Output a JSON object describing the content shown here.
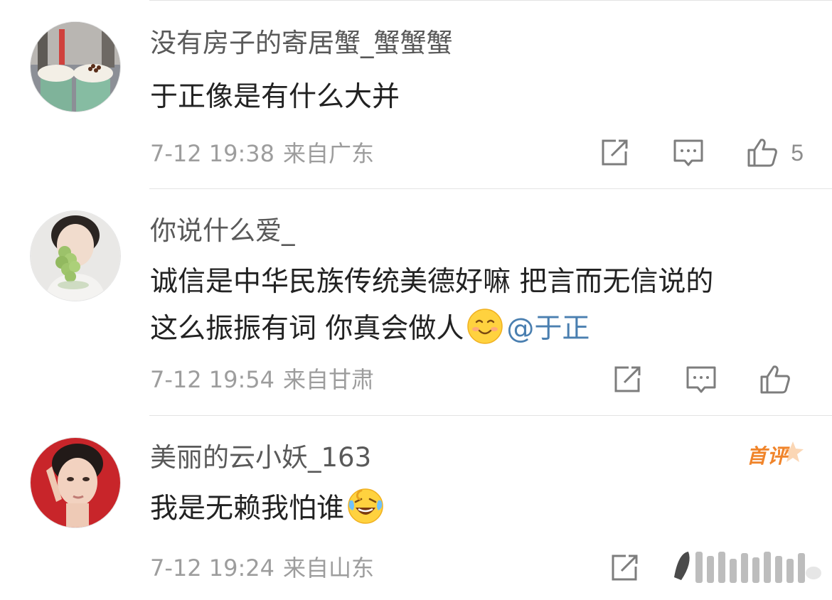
{
  "comments": [
    {
      "username": "没有房子的寄居蟹_蟹蟹蟹",
      "text": "于正像是有什么大并",
      "time": "7-12 19:38",
      "location": "来自广东",
      "likes": "5"
    },
    {
      "username": "你说什么爱_",
      "text_line1": "诚信是中华民族传统美德好嘛 把言而无信说的",
      "text_line2": "这么振振有词 你真会做人",
      "mention": "@于正",
      "time": "7-12 19:54",
      "location": "来自甘肃",
      "likes": ""
    },
    {
      "username": "美丽的云小妖_163",
      "text": "我是无赖我怕谁",
      "badge": "首评",
      "time": "7-12 19:24",
      "location": "来自山东",
      "likes": ""
    }
  ],
  "icons": {
    "share": "share-icon",
    "reply": "comment-icon",
    "like": "thumbs-up-icon",
    "emoji_smile": "smile-emoji",
    "emoji_laugh": "laugh-cry-emoji"
  },
  "colors": {
    "mention": "#4a7fb0",
    "badge": "#f0842a",
    "text": "#222222",
    "meta": "#9d9d9d"
  }
}
